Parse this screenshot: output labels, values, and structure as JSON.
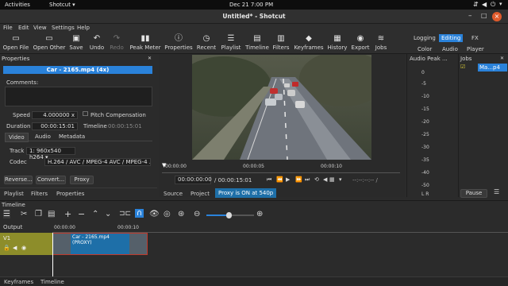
{
  "system": {
    "activities": "Activities",
    "app_menu": "Shotcut",
    "clock": "Dec 21  7:00 PM"
  },
  "window": {
    "title": "Untitled* - Shotcut"
  },
  "menu": [
    "File",
    "Edit",
    "View",
    "Settings",
    "Help"
  ],
  "toolbar": {
    "open_file": "Open File",
    "open_other": "Open Other",
    "save": "Save",
    "undo": "Undo",
    "redo": "Redo",
    "peak_meter": "Peak Meter",
    "properties": "Properties",
    "recent": "Recent",
    "playlist": "Playlist",
    "timeline": "Timeline",
    "filters": "Filters",
    "keyframes": "Keyframes",
    "history": "History",
    "export": "Export",
    "jobs": "Jobs"
  },
  "layouts": {
    "logging": "Logging",
    "editing": "Editing",
    "fx": "FX",
    "color": "Color",
    "audio": "Audio",
    "player": "Player"
  },
  "properties": {
    "header": "Properties",
    "clip_name": "Car - 2165.mp4 (4x)",
    "comments_label": "Comments:",
    "speed_label": "Speed",
    "speed_value": "4.000000 x",
    "pitch_label": "Pitch Compensation",
    "duration_label": "Duration",
    "duration_value": "00:00:15:01",
    "timeline_label": "Timeline",
    "timeline_value": "00:00:15:01",
    "tabs": [
      "Video",
      "Audio",
      "Metadata"
    ],
    "track_label": "Track",
    "track_value": "1: 960x540 h264",
    "codec_label": "Codec",
    "codec_value": "H.264 / AVC / MPEG-4 AVC / MPEG-4 ...",
    "buttons": {
      "reverse": "Reverse...",
      "convert": "Convert...",
      "proxy": "Proxy"
    }
  },
  "left_tabs": [
    "Playlist",
    "Filters",
    "Properties"
  ],
  "player": {
    "ruler": [
      "00:00:00",
      "00:00:05",
      "00:00:10"
    ],
    "position": "00:00:00:00",
    "duration": "/ 00:00:15:01",
    "in_out": "--:--:--:-- /",
    "tabs": {
      "source": "Source",
      "project": "Project",
      "proxy": "Proxy is ON at 540p"
    }
  },
  "audio_peak": {
    "header": "Audio Peak ...",
    "scale": [
      "0",
      "-5",
      "-10",
      "-15",
      "-20",
      "-25",
      "-30",
      "-35",
      "-40",
      "-50"
    ],
    "channels": "L R"
  },
  "jobs": {
    "header": "Jobs",
    "item": "Ma...p4",
    "pause": "Pause"
  },
  "timeline": {
    "header": "Timeline",
    "output_label": "Output",
    "ruler": [
      "00:00:00",
      "00:00:10"
    ],
    "track_name": "V1",
    "clip_title": "Car - 2165.mp4",
    "clip_sub": "(PROXY)"
  },
  "bottom_tabs": [
    "Keyframes",
    "Timeline"
  ],
  "colors": {
    "accent": "#2a82da",
    "clip": "#1e6fa8",
    "track": "#8d8d2a",
    "background": "#2b2b2b"
  }
}
